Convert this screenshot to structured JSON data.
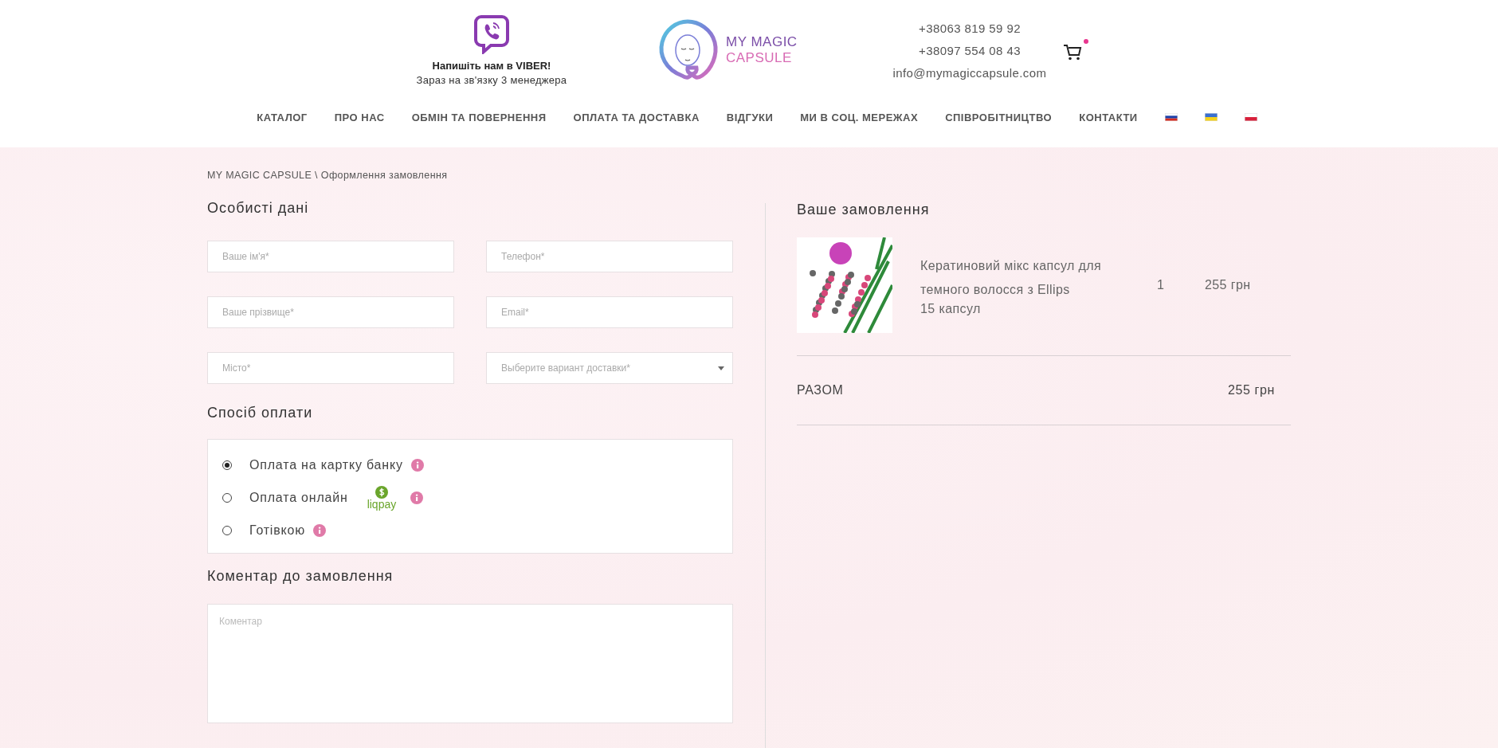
{
  "header": {
    "viber": {
      "title": "Напишіть нам в VIBER!",
      "subtitle": "Зараз на зв'язку 3 менеджера"
    },
    "logo": {
      "line1": "MY MAGIC",
      "line2": "CAPSULE"
    },
    "contacts": [
      "+38063 819 59 92",
      "+38097 554 08 43",
      "info@mymagiccapsule.com"
    ],
    "cart": {
      "has_items": true
    }
  },
  "nav": [
    "КАТАЛОГ",
    "ПРО НАС",
    "ОБМІН ТА ПОВЕРНЕННЯ",
    "ОПЛАТА ТА ДОСТАВКА",
    "ВІДГУКИ",
    "МИ В СОЦ. МЕРЕЖАХ",
    "СПІВРОБІТНИЦТВО",
    "КОНТАКТИ"
  ],
  "breadcrumb": "MY MAGIC CAPSULE \\ Оформлення замовлення",
  "personal": {
    "title": "Особисті дані",
    "fields": [
      {
        "kind": "input",
        "placeholder": "Ваше ім'я*"
      },
      {
        "kind": "input",
        "placeholder": "Телефон*"
      },
      {
        "kind": "input",
        "placeholder": "Ваше прізвище*"
      },
      {
        "kind": "input",
        "placeholder": "Email*"
      },
      {
        "kind": "input",
        "placeholder": "Місто*"
      },
      {
        "kind": "select",
        "placeholder": "Выберите вариант доставки*"
      }
    ]
  },
  "payment": {
    "title": "Спосіб оплати",
    "methods": [
      {
        "label": "Оплата на картку банку",
        "selected": true
      },
      {
        "label": "Оплата онлайн",
        "selected": false,
        "badge": "liqpay"
      },
      {
        "label": "Готівкою",
        "selected": false
      }
    ]
  },
  "comment": {
    "title": "Коментар до замовлення",
    "placeholder": "Коментар"
  },
  "order": {
    "title": "Ваше замовлення",
    "items": [
      {
        "name": "Кератиновий мікс капсул для темного волосся з Ellips",
        "variant": "15 капсул",
        "qty": "1",
        "price": "255 грн"
      }
    ],
    "total_label": "РАЗОМ",
    "total": "255 грн"
  }
}
